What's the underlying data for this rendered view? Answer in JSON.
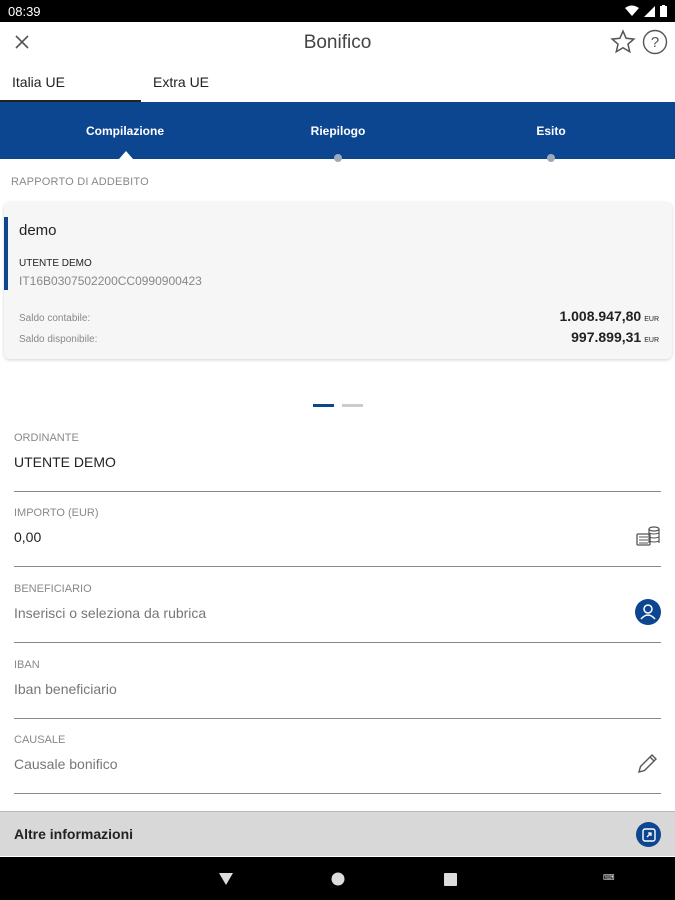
{
  "status_bar": {
    "time": "08:39"
  },
  "header": {
    "title": "Bonifico"
  },
  "region_tabs": [
    {
      "label": "Italia UE",
      "active": true
    },
    {
      "label": "Extra UE",
      "active": false
    }
  ],
  "stepper": {
    "steps": [
      {
        "label": "Compilazione",
        "active": true
      },
      {
        "label": "Riepilogo",
        "active": false
      },
      {
        "label": "Esito",
        "active": false
      }
    ]
  },
  "account_section": {
    "label": "RAPPORTO DI ADDEBITO",
    "card": {
      "name": "demo",
      "holder": "UTENTE DEMO",
      "iban": "IT16B0307502200CC0990900423",
      "saldo_contabile_label": "Saldo contabile:",
      "saldo_contabile_value": "1.008.947,80",
      "saldo_disponibile_label": "Saldo disponibile:",
      "saldo_disponibile_value": "997.899,31",
      "currency": "EUR"
    },
    "pager": {
      "pages": 2,
      "active": 1
    }
  },
  "form": {
    "ordinante": {
      "label": "ORDINANTE",
      "value": "UTENTE DEMO"
    },
    "importo": {
      "label": "IMPORTO (EUR)",
      "value": "0,00"
    },
    "beneficiario": {
      "label": "BENEFICIARIO",
      "placeholder": "Inserisci o seleziona da rubrica"
    },
    "iban": {
      "label": "IBAN",
      "placeholder": "Iban beneficiario"
    },
    "causale": {
      "label": "CAUSALE",
      "placeholder": "Causale bonifico"
    }
  },
  "altre": {
    "label": "Altre informazioni"
  },
  "icons": {
    "close": "close-icon",
    "favorite": "star-icon",
    "help": "help-icon",
    "importo": "coins-icon",
    "beneficiario": "contact-icon",
    "causale": "pencil-icon",
    "altre": "expand-icon"
  },
  "colors": {
    "brand": "#0c4590",
    "stepper_bg": "#0c4590"
  }
}
